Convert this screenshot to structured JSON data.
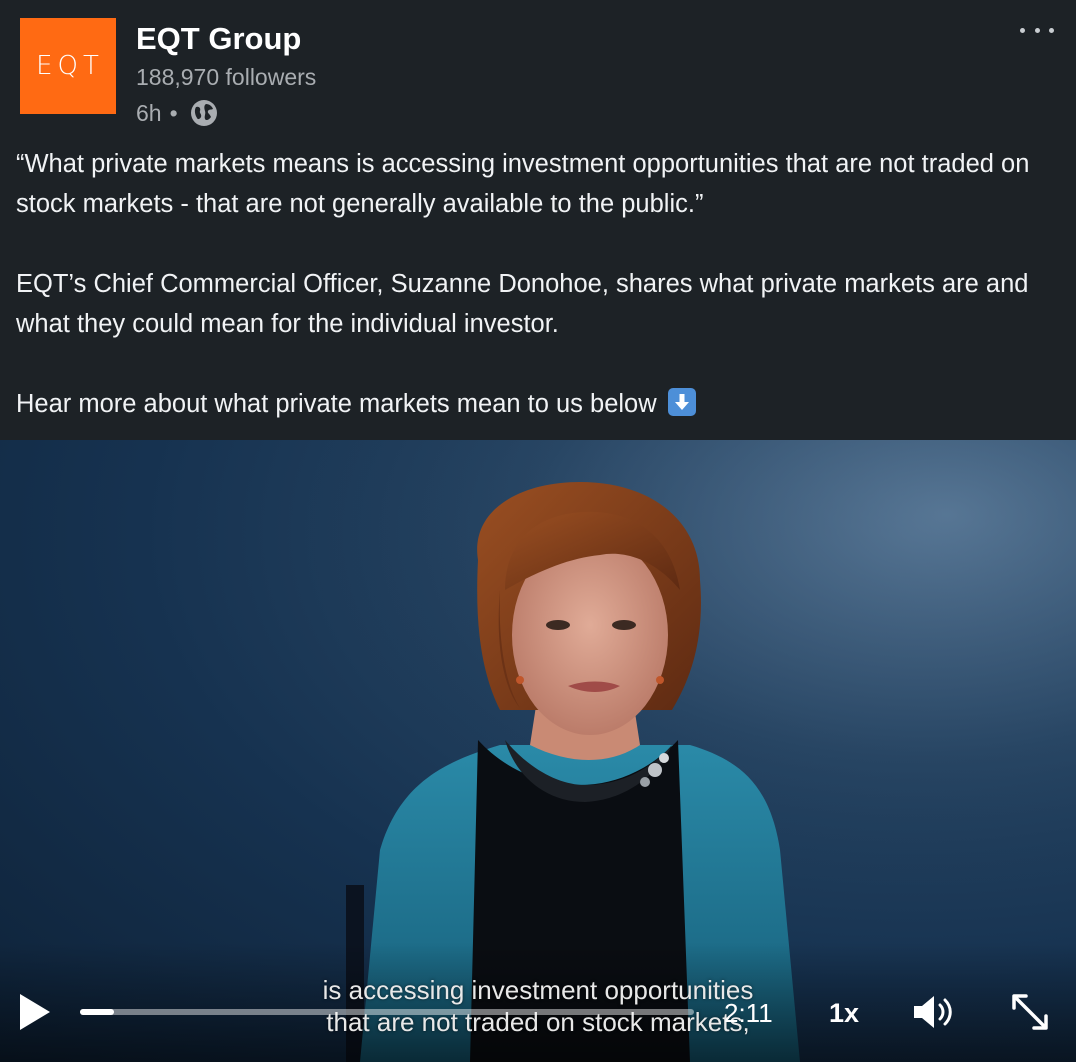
{
  "post": {
    "author": {
      "logo_text": "EQT",
      "name": "EQT Group",
      "followers": "188,970 followers",
      "time": "6h",
      "separator": "•",
      "visibility_icon": "globe-icon"
    },
    "more_icon": "ellipsis-icon",
    "text": {
      "paragraph_1": "“What private markets means is accessing investment opportunities that are not traded on stock markets - that are not generally available to the public.”",
      "paragraph_2": "EQT’s Chief Commercial Officer, Suzanne Donohoe, shares what private markets are and what they could mean for the individual investor.",
      "paragraph_3": "Hear more about what private markets mean to us below",
      "emoji": "down-arrow-emoji"
    }
  },
  "video": {
    "subtitle_line_1": "is accessing investment opportunities",
    "subtitle_line_2": "that are not traded on stock markets,",
    "time_remaining": "2:11",
    "speed": "1x",
    "progress_fraction": 0.055,
    "icons": {
      "play": "play-icon",
      "volume": "volume-icon",
      "fullscreen": "fullscreen-icon"
    }
  },
  "colors": {
    "background": "#1d2226",
    "logo": "#ff6a13",
    "secondary_text": "#a9adb1",
    "video_background": "#163250",
    "cardigan": "#1f7a96"
  }
}
